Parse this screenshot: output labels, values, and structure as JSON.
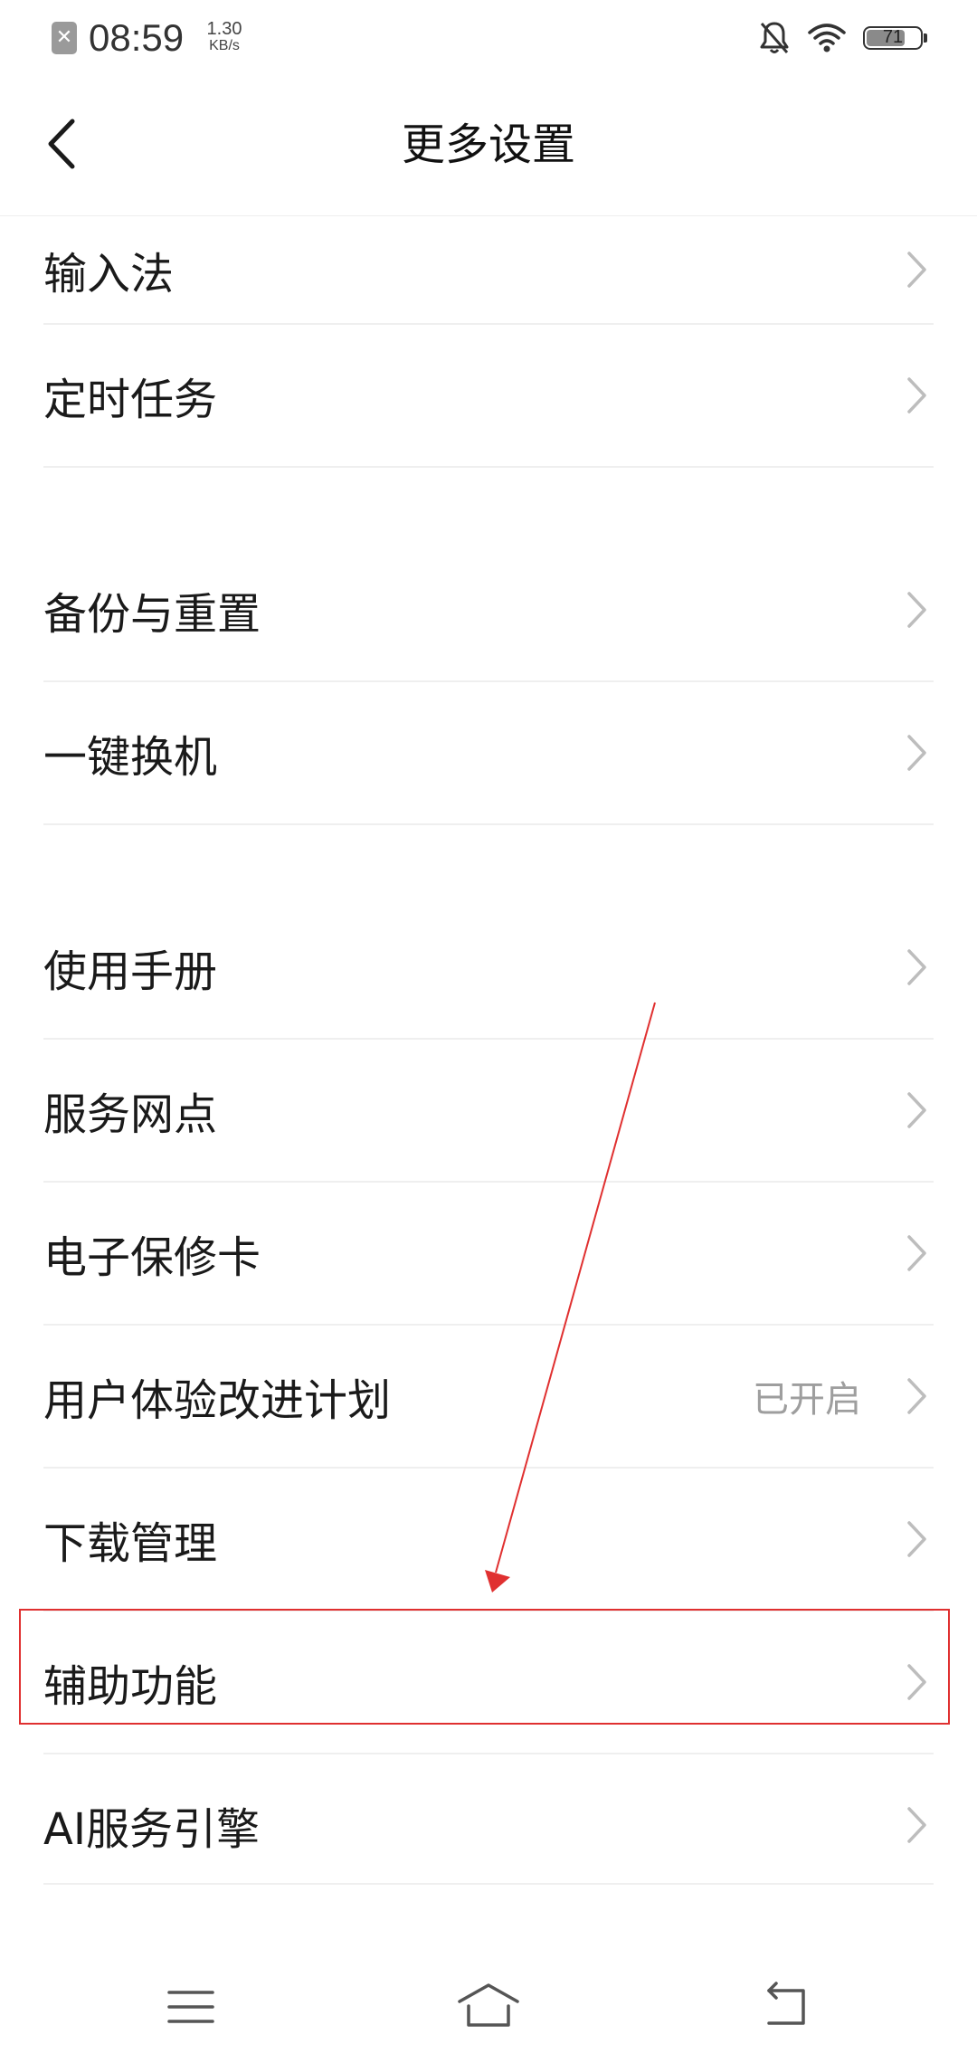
{
  "status_bar": {
    "app_icon_glyph": "✕",
    "time": "08:59",
    "speed_value": "1.30",
    "speed_unit": "KB/s",
    "battery_level": "71",
    "icons": [
      "notification-app-icon",
      "bell-off-icon",
      "wifi-icon",
      "battery-icon"
    ]
  },
  "header": {
    "title": "更多设置",
    "back_icon": "chevron-left-icon"
  },
  "settings": {
    "items": [
      {
        "label": "输入法",
        "value": ""
      },
      {
        "label": "定时任务",
        "value": ""
      },
      {
        "label": "备份与重置",
        "value": ""
      },
      {
        "label": "一键换机",
        "value": ""
      },
      {
        "label": "使用手册",
        "value": ""
      },
      {
        "label": "服务网点",
        "value": ""
      },
      {
        "label": "电子保修卡",
        "value": ""
      },
      {
        "label": "用户体验改进计划",
        "value": "已开启"
      },
      {
        "label": "下载管理",
        "value": ""
      },
      {
        "label": "辅助功能",
        "value": "",
        "highlighted": true
      },
      {
        "label": "AI服务引擎",
        "value": ""
      }
    ]
  },
  "annotation": {
    "highlight_color": "#e03030",
    "target_item": "辅助功能"
  },
  "nav_bar": {
    "icons": [
      "menu-icon",
      "home-icon",
      "back-icon"
    ]
  }
}
